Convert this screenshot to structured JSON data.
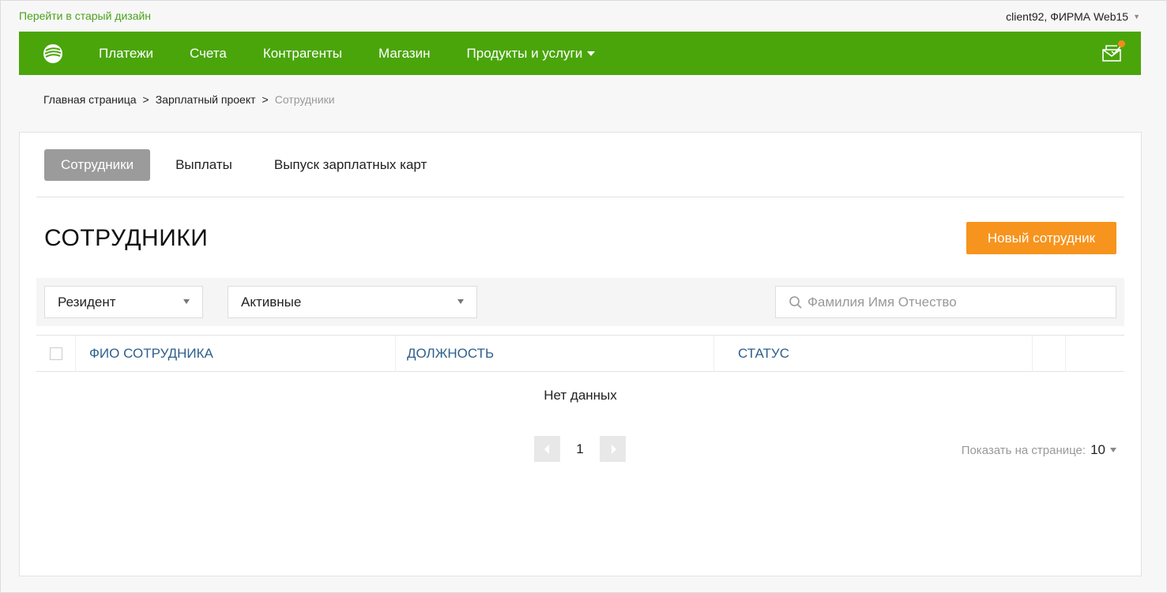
{
  "topbar": {
    "old_design_link": "Перейти в старый дизайн",
    "user_label": "client92, ФИРМА Web15"
  },
  "nav": {
    "items": [
      {
        "label": "Платежи"
      },
      {
        "label": "Счета"
      },
      {
        "label": "Контрагенты"
      },
      {
        "label": "Магазин"
      },
      {
        "label": "Продукты и услуги"
      }
    ],
    "brand_color": "#4aa50b",
    "notification_color": "#f28b1a"
  },
  "breadcrumb": {
    "items": [
      "Главная страница",
      "Зарплатный проект"
    ],
    "separator": ">",
    "current": "Сотрудники"
  },
  "tabs": [
    {
      "label": "Сотрудники",
      "active": true
    },
    {
      "label": "Выплаты",
      "active": false
    },
    {
      "label": "Выпуск зарплатных карт",
      "active": false
    }
  ],
  "page": {
    "title": "СОТРУДНИКИ",
    "new_button": "Новый сотрудник",
    "accent_color": "#f7941d"
  },
  "filters": {
    "resident": "Резидент",
    "status": "Активные",
    "search_placeholder": "Фамилия Имя Отчество"
  },
  "table": {
    "columns": [
      "ФИО СОТРУДНИКА",
      "ДОЛЖНОСТЬ",
      "СТАТУС"
    ],
    "empty_text": "Нет данных"
  },
  "pagination": {
    "current_page": "1",
    "per_page_label": "Показать на странице:",
    "per_page_value": "10"
  }
}
